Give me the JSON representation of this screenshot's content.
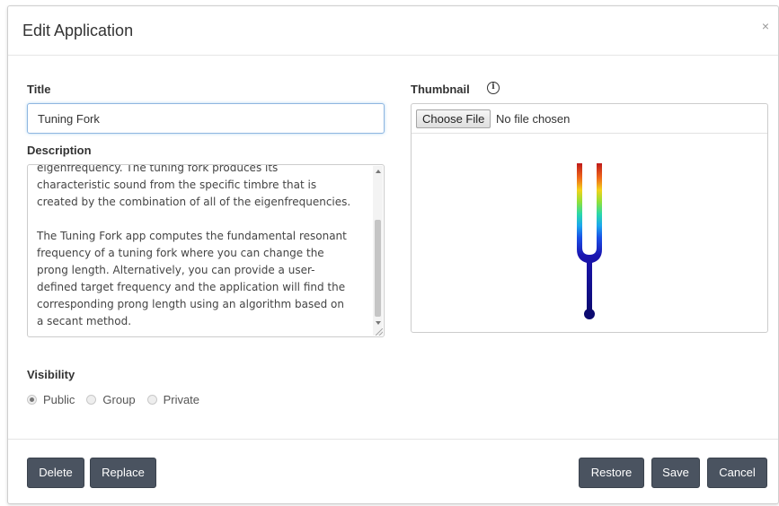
{
  "modal": {
    "title": "Edit Application",
    "close_label": "×"
  },
  "form": {
    "title_label": "Title",
    "title_value": "Tuning Fork",
    "description_label": "Description",
    "description_value": "eigenfrequency. The tuning fork produces its\ncharacteristic sound from the specific timbre that is\ncreated by the combination of all of the eigenfrequencies.\n\nThe Tuning Fork app computes the fundamental resonant\nfrequency of a tuning fork where you can change the\nprong length. Alternatively, you can provide a user-\ndefined target frequency and the application will find the\ncorresponding prong length using an algorithm based on\na secant method.",
    "thumbnail_label": "Thumbnail",
    "info_icon": "i",
    "choose_file_label": "Choose File",
    "no_file_text": "No file chosen",
    "visibility_label": "Visibility",
    "visibility_options": [
      "Public",
      "Group",
      "Private"
    ],
    "visibility_selected": "Public"
  },
  "footer": {
    "delete_label": "Delete",
    "replace_label": "Replace",
    "restore_label": "Restore",
    "save_label": "Save",
    "cancel_label": "Cancel"
  },
  "colors": {
    "button_bg": "#4a5360",
    "input_focus_border": "#8fb6e0"
  }
}
